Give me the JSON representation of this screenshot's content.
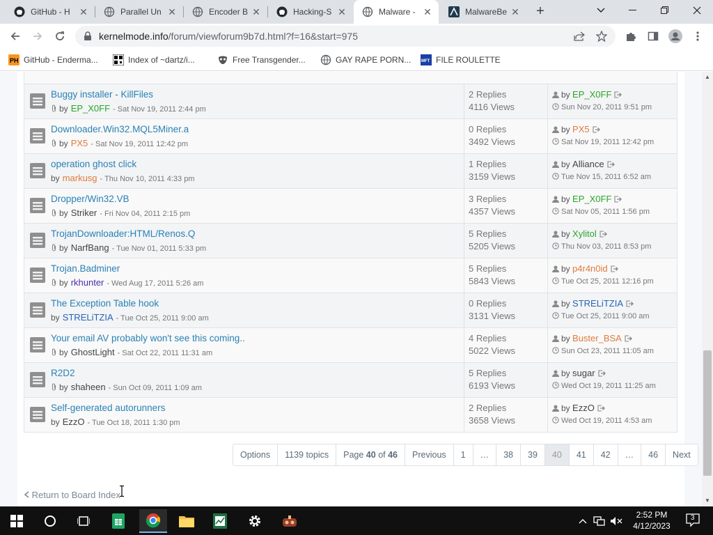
{
  "tabs": [
    {
      "title": "GitHub - H",
      "icon": "github-icon",
      "active": false
    },
    {
      "title": "Parallel Un",
      "icon": "globe-icon",
      "active": false
    },
    {
      "title": "Encoder B",
      "icon": "globe-icon",
      "active": false
    },
    {
      "title": "Hacking-S",
      "icon": "github-icon",
      "active": false
    },
    {
      "title": "Malware -",
      "icon": "globe-icon",
      "active": true
    },
    {
      "title": "MalwareBe",
      "icon": "malwarebenchmark-icon",
      "active": false
    }
  ],
  "toolbar": {
    "url_host": "kernelmode.info",
    "url_path": "/forum/viewforum9b7d.html?f=16&start=975"
  },
  "bookmarks": [
    {
      "label": "GitHub - Enderma...",
      "icon": "ph-icon"
    },
    {
      "label": "Index of ~dartz/i...",
      "icon": "qr-icon"
    },
    {
      "label": "Free Transgender...",
      "icon": "mask-icon"
    },
    {
      "label": "GAY RAPE PORN...",
      "icon": "globe-icon"
    },
    {
      "label": "FILE ROULETTE",
      "icon": "mft-icon"
    }
  ],
  "topics": [
    {
      "title": "Buggy installer - KillFiles",
      "by": "by",
      "author": "EP_X0FF",
      "author_color": "green",
      "date": "- Sat Nov 19, 2011 2:44 pm",
      "attach": true,
      "replies": "2 Replies",
      "views": "4116 Views",
      "last_by": "by",
      "last_author": "EP_X0FF",
      "last_color": "green",
      "last_date": "Sun Nov 20, 2011 9:51 pm"
    },
    {
      "title": "Downloader.Win32.MQL5Miner.a",
      "by": "by",
      "author": "PX5",
      "author_color": "orange",
      "date": "- Sat Nov 19, 2011 12:42 pm",
      "attach": true,
      "replies": "0 Replies",
      "views": "3492 Views",
      "last_by": "by",
      "last_author": "PX5",
      "last_color": "orange",
      "last_date": "Sat Nov 19, 2011 12:42 pm"
    },
    {
      "title": "operation ghost click",
      "by": "by",
      "author": "markusg",
      "author_color": "orange",
      "date": "- Thu Nov 10, 2011 4:33 pm",
      "attach": false,
      "replies": "1 Replies",
      "views": "3159 Views",
      "last_by": "by",
      "last_author": "Alliance",
      "last_color": "dark",
      "last_date": "Tue Nov 15, 2011 6:52 am"
    },
    {
      "title": "Dropper/Win32.VB",
      "by": "by",
      "author": "Striker",
      "author_color": "dark",
      "date": "- Fri Nov 04, 2011 2:15 pm",
      "attach": true,
      "replies": "3 Replies",
      "views": "4357 Views",
      "last_by": "by",
      "last_author": "EP_X0FF",
      "last_color": "green",
      "last_date": "Sat Nov 05, 2011 1:56 pm"
    },
    {
      "title": "TrojanDownloader:HTML/Renos.Q",
      "by": "by",
      "author": "NarfBang",
      "author_color": "dark",
      "date": "- Tue Nov 01, 2011 5:33 pm",
      "attach": true,
      "replies": "5 Replies",
      "views": "5205 Views",
      "last_by": "by",
      "last_author": "Xylitol",
      "last_color": "green",
      "last_date": "Thu Nov 03, 2011 8:53 pm"
    },
    {
      "title": "Trojan.Badminer",
      "by": "by",
      "author": "rkhunter",
      "author_color": "purple",
      "date": "- Wed Aug 17, 2011 5:26 am",
      "attach": true,
      "replies": "5 Replies",
      "views": "5843 Views",
      "last_by": "by",
      "last_author": "p4r4n0id",
      "last_color": "orange",
      "last_date": "Tue Oct 25, 2011 12:16 pm"
    },
    {
      "title": "The Exception Table hook",
      "by": "by",
      "author": "STRELiTZIA",
      "author_color": "blue",
      "date": "- Tue Oct 25, 2011 9:00 am",
      "attach": false,
      "replies": "0 Replies",
      "views": "3131 Views",
      "last_by": "by",
      "last_author": "STRELiTZIA",
      "last_color": "blue",
      "last_date": "Tue Oct 25, 2011 9:00 am"
    },
    {
      "title": "Your email AV probably won't see this coming..",
      "by": "by",
      "author": "GhostLight",
      "author_color": "dark",
      "date": "- Sat Oct 22, 2011 11:31 am",
      "attach": true,
      "replies": "4 Replies",
      "views": "5022 Views",
      "last_by": "by",
      "last_author": "Buster_BSA",
      "last_color": "orange",
      "last_date": "Sun Oct 23, 2011 11:05 am"
    },
    {
      "title": "R2D2",
      "by": "by",
      "author": "shaheen",
      "author_color": "dark",
      "date": "- Sun Oct 09, 2011 1:09 am",
      "attach": true,
      "replies": "5 Replies",
      "views": "6193 Views",
      "last_by": "by",
      "last_author": "sugar",
      "last_color": "dark",
      "last_date": "Wed Oct 19, 2011 11:25 am"
    },
    {
      "title": "Self-generated autorunners",
      "by": "by",
      "author": "EzzO",
      "author_color": "dark",
      "date": "- Tue Oct 18, 2011 1:30 pm",
      "attach": false,
      "replies": "2 Replies",
      "views": "3658 Views",
      "last_by": "by",
      "last_author": "EzzO",
      "last_color": "dark",
      "last_date": "Wed Oct 19, 2011 4:53 am"
    }
  ],
  "pagination": {
    "options": "Options",
    "topics": "1139 topics",
    "page_prefix": "Page",
    "page_current": "40",
    "page_of": "of",
    "page_total": "46",
    "previous": "Previous",
    "pages": [
      "1",
      "…",
      "38",
      "39",
      "40",
      "41",
      "42",
      "…",
      "46"
    ],
    "current_page": "40",
    "next": "Next"
  },
  "return_link": "Return to Board Index",
  "taskbar": {
    "time": "2:52 PM",
    "date": "4/12/2023",
    "notifications": "3"
  },
  "colors": {
    "link": "#2a81b4",
    "green_user": "#2aa52a",
    "orange_user": "#e27a3c",
    "purple_user": "#4b2eaa",
    "blue_user": "#2862b4"
  }
}
